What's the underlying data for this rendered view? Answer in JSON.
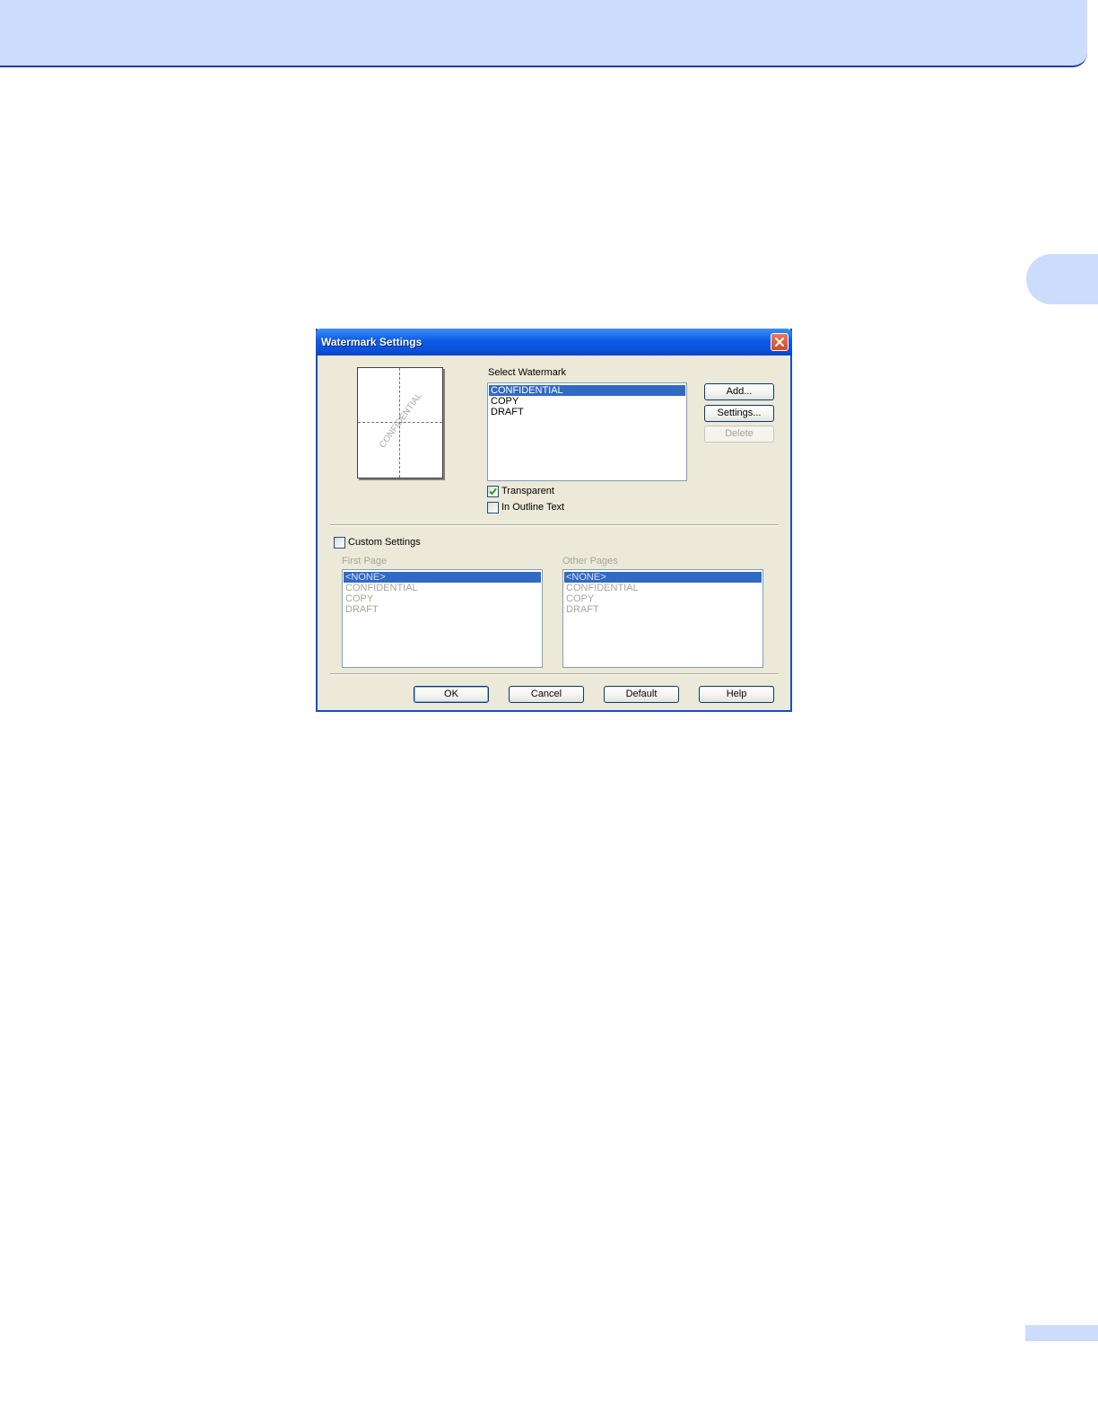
{
  "dialog": {
    "title": "Watermark Settings",
    "preview_watermark_text": "CONFIDENTIAL",
    "select_watermark_label": "Select Watermark",
    "watermark_items": [
      "CONFIDENTIAL",
      "COPY",
      "DRAFT"
    ],
    "selected_watermark": "CONFIDENTIAL",
    "add_label": "Add...",
    "settings_label": "Settings...",
    "delete_label": "Delete",
    "transparent_label": "Transparent",
    "transparent_checked": true,
    "outline_label": "In Outline Text",
    "outline_checked": false,
    "custom_settings_label": "Custom Settings",
    "custom_settings_checked": false,
    "first_page_label": "First Page",
    "other_pages_label": "Other Pages",
    "page_items": [
      "<NONE>",
      "CONFIDENTIAL",
      "COPY",
      "DRAFT"
    ],
    "ok_label": "OK",
    "cancel_label": "Cancel",
    "default_label": "Default",
    "help_label": "Help"
  },
  "colors": {
    "selection": "#316ac5",
    "dialog_bg": "#ece9d8",
    "title_bar": "#0a52d8",
    "page_band": "#ccdcfd"
  },
  "icons": [
    "close-icon",
    "checkmark-icon"
  ]
}
